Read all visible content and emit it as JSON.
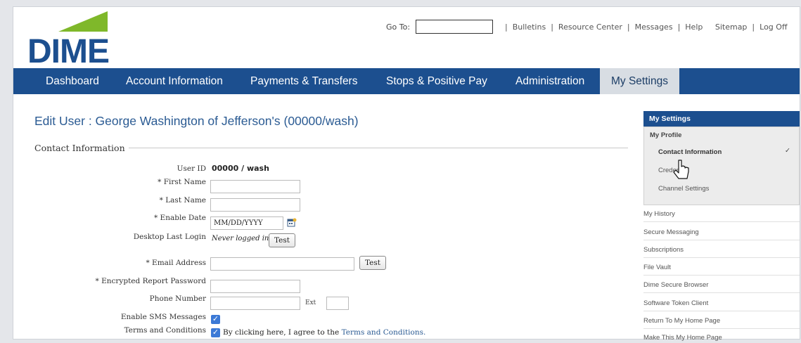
{
  "header": {
    "logo_text": "DIME",
    "goto_label": "Go To:",
    "links": [
      "Bulletins",
      "Resource Center",
      "Messages",
      "Help",
      "Sitemap",
      "Log Off"
    ]
  },
  "nav": {
    "items": [
      "Dashboard",
      "Account Information",
      "Payments & Transfers",
      "Stops & Positive Pay",
      "Administration",
      "My Settings"
    ],
    "active": "My Settings"
  },
  "page": {
    "title": "Edit User : George Washington of Jefferson's (00000/wash)",
    "section": "Contact Information"
  },
  "form": {
    "user_id_label": "User ID",
    "user_id_value": "00000 / wash",
    "first_name_label": "* First Name",
    "last_name_label": "* Last Name",
    "enable_date_label": "* Enable Date",
    "enable_date_value": "MM/DD/YYYY",
    "desktop_login_label": "Desktop Last Login",
    "desktop_login_value": "Never logged in",
    "test_button": "Test",
    "email_label": "* Email Address",
    "email_test_button": "Test",
    "encrypted_label": "* Encrypted Report Password",
    "phone_label": "Phone Number",
    "ext_label": "Ext",
    "sms_label": "Enable SMS Messages",
    "terms_label": "Terms and Conditions",
    "terms_text": "By clicking here, I agree to the",
    "terms_link": "Terms and Conditions."
  },
  "sidebar": {
    "header": "My Settings",
    "profile": "My Profile",
    "sub_items": [
      "Contact Information",
      "Credentials",
      "Channel Settings"
    ],
    "credentials_visible": "Creden",
    "items": [
      "My History",
      "Secure Messaging",
      "Subscriptions",
      "File Vault",
      "Dime Secure Browser",
      "Software Token Client",
      "Return To My Home Page",
      "Make This My Home Page"
    ]
  },
  "colors": {
    "brand_blue": "#1c4f8f",
    "logo_green": "#7fb82a",
    "title_blue": "#2b5b93",
    "checkbox": "#3b79d6"
  }
}
